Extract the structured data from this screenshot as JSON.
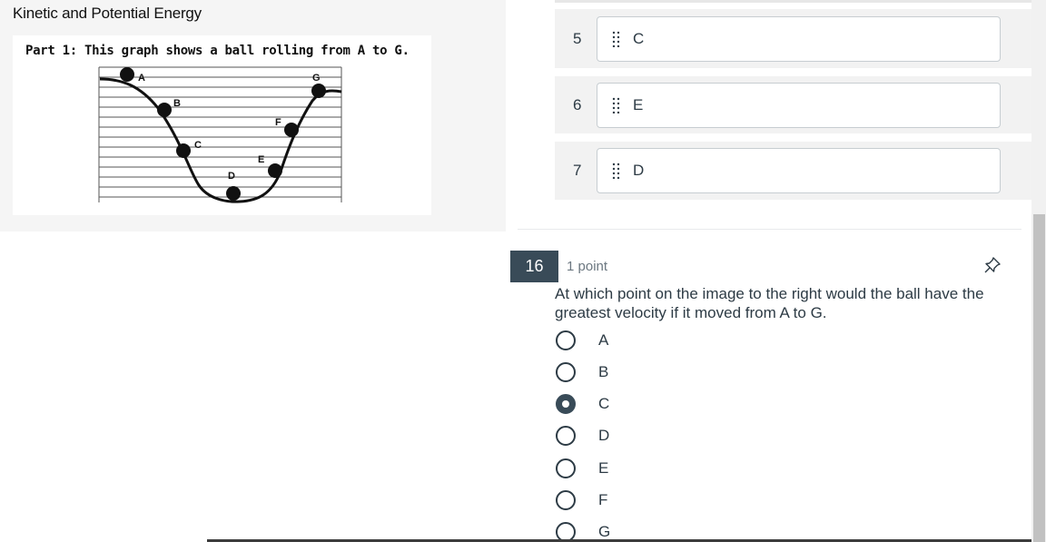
{
  "stimulus": {
    "title": "Kinetic and Potential Energy",
    "caption": "Part 1: This graph shows a ball rolling from A to G.",
    "figure_labels": [
      "A",
      "B",
      "C",
      "D",
      "E",
      "F",
      "G"
    ]
  },
  "ordering": {
    "rows": [
      {
        "number": "5",
        "value": "C"
      },
      {
        "number": "6",
        "value": "E"
      },
      {
        "number": "7",
        "value": "D"
      }
    ]
  },
  "question": {
    "number": "16",
    "points": "1 point",
    "text": "At which point on the image to the right would the ball have the greatest velocity if it moved from A to G.",
    "options": [
      {
        "label": "A",
        "selected": false
      },
      {
        "label": "B",
        "selected": false
      },
      {
        "label": "C",
        "selected": true
      },
      {
        "label": "D",
        "selected": false
      },
      {
        "label": "E",
        "selected": false
      },
      {
        "label": "F",
        "selected": false
      },
      {
        "label": "G",
        "selected": false
      }
    ]
  },
  "icons": {
    "drag": "drag-handle-icon",
    "pin": "pin-icon"
  },
  "colors": {
    "accent": "#394b58",
    "text": "#2d3b45",
    "panel": "#f5f5f5"
  }
}
